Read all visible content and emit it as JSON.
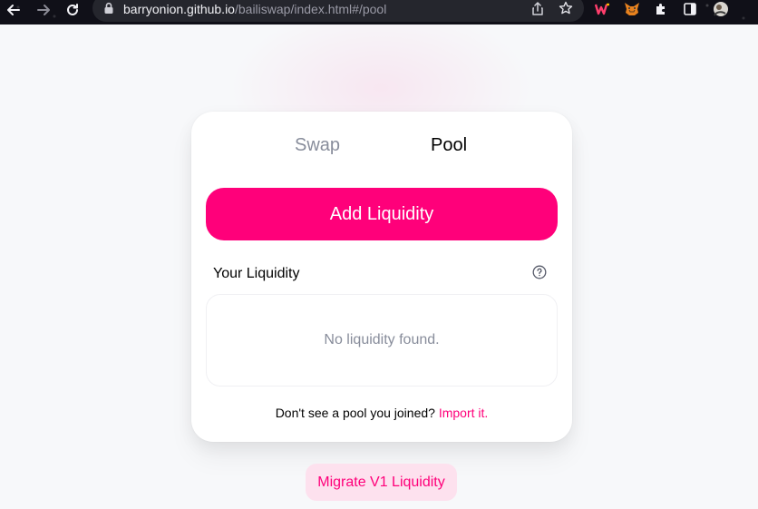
{
  "browser": {
    "url_host": "barryonion.github.io",
    "url_path": "/bailiswap/index.html#/pool",
    "back_icon": "arrow-left-icon",
    "forward_icon": "arrow-right-icon",
    "reload_icon": "reload-icon",
    "lock_icon": "lock-icon",
    "share_icon": "share-icon",
    "star_icon": "star-icon",
    "extensions": [
      "w-extension-icon",
      "metamask-fox-icon",
      "puzzle-extensions-icon",
      "sidebar-icon",
      "profile-avatar-icon"
    ]
  },
  "tabs": {
    "swap": "Swap",
    "pool": "Pool",
    "active": "pool"
  },
  "pool": {
    "add_liquidity_label": "Add Liquidity",
    "your_liquidity_title": "Your Liquidity",
    "help_icon": "question-circle-icon",
    "empty_text": "No liquidity found.",
    "import_prompt": "Don't see a pool you joined?",
    "import_link": "Import it."
  },
  "migrate": {
    "label": "Migrate V1 Liquidity"
  },
  "colors": {
    "accent": "#ff007a",
    "accent_soft": "#fde1ee",
    "muted_text": "#888d9b",
    "page_bg": "#f7f8fa"
  }
}
